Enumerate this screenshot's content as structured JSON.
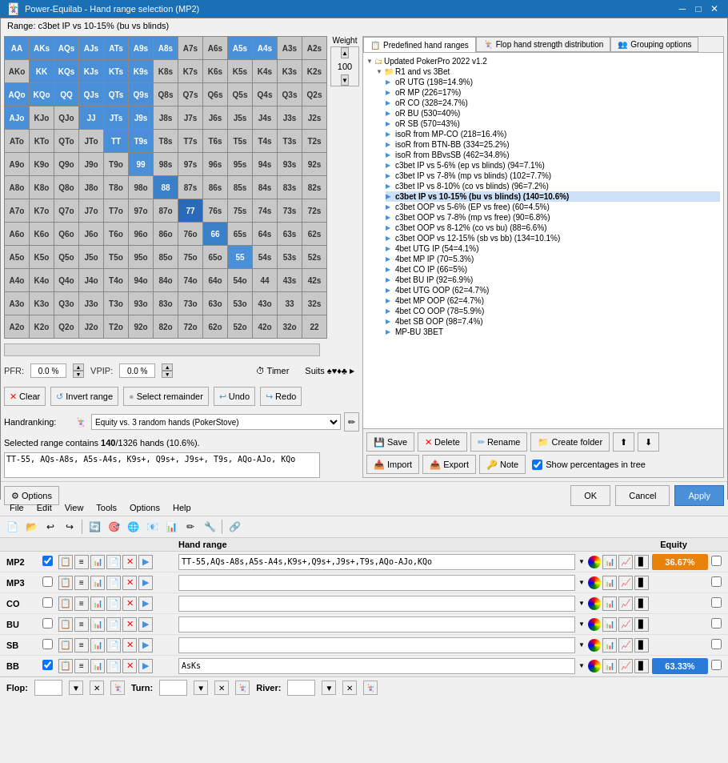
{
  "titleBar": {
    "title": "Power-Equilab - Hand range selection (MP2)",
    "minBtn": "─",
    "maxBtn": "□",
    "closeBtn": "✕"
  },
  "mainWindow": {
    "rangeLabel": "Range: c3bet IP vs 10-15% (bu vs blinds)",
    "weightLabel": "Weight",
    "weightValue": "100"
  },
  "handGrid": {
    "cells": [
      {
        "label": "AA",
        "style": "blue"
      },
      {
        "label": "AKs",
        "style": "blue"
      },
      {
        "label": "AQs",
        "style": "blue"
      },
      {
        "label": "AJs",
        "style": "blue"
      },
      {
        "label": "ATs",
        "style": "blue"
      },
      {
        "label": "A9s",
        "style": "blue"
      },
      {
        "label": "A8s",
        "style": "blue"
      },
      {
        "label": "A7s",
        "style": "gray"
      },
      {
        "label": "A6s",
        "style": "gray"
      },
      {
        "label": "A5s",
        "style": "blue"
      },
      {
        "label": "A4s",
        "style": "blue"
      },
      {
        "label": "A3s",
        "style": "gray"
      },
      {
        "label": "A2s",
        "style": "gray"
      },
      {
        "label": "AKo",
        "style": "gray"
      },
      {
        "label": "KK",
        "style": "blue"
      },
      {
        "label": "KQs",
        "style": "blue"
      },
      {
        "label": "KJs",
        "style": "blue"
      },
      {
        "label": "KTs",
        "style": "blue"
      },
      {
        "label": "K9s",
        "style": "blue"
      },
      {
        "label": "K8s",
        "style": "gray"
      },
      {
        "label": "K7s",
        "style": "gray"
      },
      {
        "label": "K6s",
        "style": "gray"
      },
      {
        "label": "K5s",
        "style": "gray"
      },
      {
        "label": "K4s",
        "style": "gray"
      },
      {
        "label": "K3s",
        "style": "gray"
      },
      {
        "label": "K2s",
        "style": "gray"
      },
      {
        "label": "AQo",
        "style": "blue"
      },
      {
        "label": "KQo",
        "style": "gray"
      },
      {
        "label": "QQ",
        "style": "blue"
      },
      {
        "label": "QJs",
        "style": "blue"
      },
      {
        "label": "QTs",
        "style": "blue"
      },
      {
        "label": "Q9s",
        "style": "blue"
      },
      {
        "label": "Q8s",
        "style": "gray"
      },
      {
        "label": "Q7s",
        "style": "gray"
      },
      {
        "label": "Q6s",
        "style": "gray"
      },
      {
        "label": "Q5s",
        "style": "gray"
      },
      {
        "label": "Q4s",
        "style": "gray"
      },
      {
        "label": "Q3s",
        "style": "gray"
      },
      {
        "label": "Q2s",
        "style": "gray"
      },
      {
        "label": "AJo",
        "style": "blue"
      },
      {
        "label": "KJo",
        "style": "gray"
      },
      {
        "label": "QJo",
        "style": "gray"
      },
      {
        "label": "JJ",
        "style": "blue"
      },
      {
        "label": "JTs",
        "style": "blue"
      },
      {
        "label": "J9s",
        "style": "blue"
      },
      {
        "label": "J8s",
        "style": "gray"
      },
      {
        "label": "J7s",
        "style": "gray"
      },
      {
        "label": "J6s",
        "style": "gray"
      },
      {
        "label": "J5s",
        "style": "gray"
      },
      {
        "label": "J4s",
        "style": "gray"
      },
      {
        "label": "J3s",
        "style": "gray"
      },
      {
        "label": "J2s",
        "style": "gray"
      },
      {
        "label": "ATo",
        "style": "gray"
      },
      {
        "label": "KTo",
        "style": "gray"
      },
      {
        "label": "QTo",
        "style": "gray"
      },
      {
        "label": "JTo",
        "style": "gray"
      },
      {
        "label": "TT",
        "style": "blue"
      },
      {
        "label": "T9s",
        "style": "blue"
      },
      {
        "label": "T8s",
        "style": "gray"
      },
      {
        "label": "T7s",
        "style": "gray"
      },
      {
        "label": "T6s",
        "style": "gray"
      },
      {
        "label": "T5s",
        "style": "gray"
      },
      {
        "label": "T4s",
        "style": "gray"
      },
      {
        "label": "T3s",
        "style": "gray"
      },
      {
        "label": "T2s",
        "style": "gray"
      },
      {
        "label": "A9o",
        "style": "gray"
      },
      {
        "label": "K9o",
        "style": "gray"
      },
      {
        "label": "Q9o",
        "style": "gray"
      },
      {
        "label": "J9o",
        "style": "gray"
      },
      {
        "label": "T9o",
        "style": "gray"
      },
      {
        "label": "99",
        "style": "blue"
      },
      {
        "label": "98s",
        "style": "gray"
      },
      {
        "label": "97s",
        "style": "gray"
      },
      {
        "label": "96s",
        "style": "gray"
      },
      {
        "label": "95s",
        "style": "gray"
      },
      {
        "label": "94s",
        "style": "gray"
      },
      {
        "label": "93s",
        "style": "gray"
      },
      {
        "label": "92s",
        "style": "gray"
      },
      {
        "label": "A8o",
        "style": "gray"
      },
      {
        "label": "K8o",
        "style": "gray"
      },
      {
        "label": "Q8o",
        "style": "gray"
      },
      {
        "label": "J8o",
        "style": "gray"
      },
      {
        "label": "T8o",
        "style": "gray"
      },
      {
        "label": "98o",
        "style": "gray"
      },
      {
        "label": "88",
        "style": "blue"
      },
      {
        "label": "87s",
        "style": "gray"
      },
      {
        "label": "86s",
        "style": "gray"
      },
      {
        "label": "85s",
        "style": "gray"
      },
      {
        "label": "84s",
        "style": "gray"
      },
      {
        "label": "83s",
        "style": "gray"
      },
      {
        "label": "82s",
        "style": "gray"
      },
      {
        "label": "A7o",
        "style": "gray"
      },
      {
        "label": "K7o",
        "style": "gray"
      },
      {
        "label": "Q7o",
        "style": "gray"
      },
      {
        "label": "J7o",
        "style": "gray"
      },
      {
        "label": "T7o",
        "style": "gray"
      },
      {
        "label": "97o",
        "style": "gray"
      },
      {
        "label": "87o",
        "style": "gray"
      },
      {
        "label": "77",
        "style": "blue"
      },
      {
        "label": "76s",
        "style": "gray"
      },
      {
        "label": "75s",
        "style": "gray"
      },
      {
        "label": "74s",
        "style": "gray"
      },
      {
        "label": "73s",
        "style": "gray"
      },
      {
        "label": "72s",
        "style": "gray"
      },
      {
        "label": "A6o",
        "style": "gray"
      },
      {
        "label": "K6o",
        "style": "gray"
      },
      {
        "label": "Q6o",
        "style": "gray"
      },
      {
        "label": "J6o",
        "style": "gray"
      },
      {
        "label": "T6o",
        "style": "gray"
      },
      {
        "label": "96o",
        "style": "gray"
      },
      {
        "label": "86o",
        "style": "gray"
      },
      {
        "label": "76o",
        "style": "gray"
      },
      {
        "label": "66",
        "style": "blue"
      },
      {
        "label": "65s",
        "style": "gray"
      },
      {
        "label": "64s",
        "style": "gray"
      },
      {
        "label": "63s",
        "style": "gray"
      },
      {
        "label": "62s",
        "style": "gray"
      },
      {
        "label": "A5o",
        "style": "gray"
      },
      {
        "label": "K5o",
        "style": "gray"
      },
      {
        "label": "Q5o",
        "style": "gray"
      },
      {
        "label": "J5o",
        "style": "gray"
      },
      {
        "label": "T5o",
        "style": "gray"
      },
      {
        "label": "95o",
        "style": "gray"
      },
      {
        "label": "85o",
        "style": "gray"
      },
      {
        "label": "75o",
        "style": "gray"
      },
      {
        "label": "65o",
        "style": "gray"
      },
      {
        "label": "55",
        "style": "blue"
      },
      {
        "label": "54s",
        "style": "gray"
      },
      {
        "label": "53s",
        "style": "gray"
      },
      {
        "label": "52s",
        "style": "gray"
      },
      {
        "label": "A4o",
        "style": "gray"
      },
      {
        "label": "K4o",
        "style": "gray"
      },
      {
        "label": "Q4o",
        "style": "gray"
      },
      {
        "label": "J4o",
        "style": "gray"
      },
      {
        "label": "T4o",
        "style": "gray"
      },
      {
        "label": "94o",
        "style": "gray"
      },
      {
        "label": "84o",
        "style": "gray"
      },
      {
        "label": "74o",
        "style": "gray"
      },
      {
        "label": "64o",
        "style": "gray"
      },
      {
        "label": "54o",
        "style": "gray"
      },
      {
        "label": "44",
        "style": "gray"
      },
      {
        "label": "43s",
        "style": "gray"
      },
      {
        "label": "42s",
        "style": "gray"
      },
      {
        "label": "A3o",
        "style": "gray"
      },
      {
        "label": "K3o",
        "style": "gray"
      },
      {
        "label": "Q3o",
        "style": "gray"
      },
      {
        "label": "J3o",
        "style": "gray"
      },
      {
        "label": "T3o",
        "style": "gray"
      },
      {
        "label": "93o",
        "style": "gray"
      },
      {
        "label": "83o",
        "style": "gray"
      },
      {
        "label": "73o",
        "style": "gray"
      },
      {
        "label": "63o",
        "style": "gray"
      },
      {
        "label": "53o",
        "style": "gray"
      },
      {
        "label": "43o",
        "style": "gray"
      },
      {
        "label": "33",
        "style": "gray"
      },
      {
        "label": "32s",
        "style": "gray"
      },
      {
        "label": "A2o",
        "style": "gray"
      },
      {
        "label": "K2o",
        "style": "gray"
      },
      {
        "label": "Q2o",
        "style": "gray"
      },
      {
        "label": "J2o",
        "style": "gray"
      },
      {
        "label": "T2o",
        "style": "gray"
      },
      {
        "label": "92o",
        "style": "gray"
      },
      {
        "label": "82o",
        "style": "gray"
      },
      {
        "label": "72o",
        "style": "gray"
      },
      {
        "label": "62o",
        "style": "gray"
      },
      {
        "label": "52o",
        "style": "gray"
      },
      {
        "label": "42o",
        "style": "gray"
      },
      {
        "label": "32o",
        "style": "gray"
      },
      {
        "label": "22",
        "style": "gray"
      }
    ]
  },
  "stats": {
    "pfrLabel": "PFR:",
    "pfrValue": "0.0 %",
    "vpipLabel": "VPIP:",
    "vpipValue": "0.0 %",
    "timerLabel": "Timer",
    "suitsLabel": "Suits"
  },
  "actions": {
    "clearLabel": "Clear",
    "invertLabel": "Invert range",
    "selectRemLabel": "Select remainder",
    "undoLabel": "Undo",
    "redoLabel": "Redo"
  },
  "handranking": {
    "label": "Handranking:",
    "value": "Equity vs. 3 random hands (PokerStove)"
  },
  "selectedInfo": {
    "text": "Selected range contains ",
    "bold": "140",
    "rest": "/1326 hands (10.6%)."
  },
  "rangeText": "TT-55, AQs-A8s, A5s-A4s, K9s+, Q9s+, J9s+, T9s, AQo-AJo, KQo",
  "tree": {
    "tab1": "Predefined hand ranges",
    "tab2": "Flop hand strength distribution",
    "tab3": "Grouping options",
    "root": "Updated PokerPro 2022 v1.2",
    "folder1": "R1 and vs 3Bet",
    "items": [
      "oR UTG (198=14.9%)",
      "oR MP (226=17%)",
      "oR CO (328=24.7%)",
      "oR BU (530=40%)",
      "oR SB (570=43%)",
      "isoR from MP-CO (218=16.4%)",
      "isoR from BTN-BB (334=25.2%)",
      "isoR from BBvsSB (462=34.8%)",
      "c3bet IP vs 5-6% (ep vs blinds) (94=7.1%)",
      "c3bet IP vs 7-8% (mp vs blinds) (102=7.7%)",
      "c3bet IP vs 8-10% (co vs blinds) (96=7.2%)",
      "c3bet IP vs 10-15% (bu vs blinds) (140=10.6%)",
      "c3bet OOP vs 5-6% (EP vs free) (60=4.5%)",
      "c3bet OOP vs 7-8% (mp vs free) (90=6.8%)",
      "c3bet OOP vs 8-12% (co vs bu) (88=6.6%)",
      "c3bet OOP vs 12-15% (sb vs bb) (134=10.1%)",
      "4bet UTG IP (54=4.1%)",
      "4bet MP IP (70=5.3%)",
      "4bet CO IP (66=5%)",
      "4bet BU IP (92=6.9%)",
      "4bet UTG OOP (62=4.7%)",
      "4bet MP OOP (62=4.7%)",
      "4bet CO OOP (78=5.9%)",
      "4bet SB OOP (98=7.4%)",
      "MP-BU 3BET"
    ]
  },
  "treeButtons": {
    "save": "Save",
    "delete": "Delete",
    "rename": "Rename",
    "createFolder": "Create folder",
    "importUp": "▲",
    "importDown": "▼",
    "import": "Import",
    "export": "Export",
    "note": "Note",
    "showPct": "Show percentages in tree"
  },
  "bottomSection": {
    "menuItems": [
      "File",
      "Edit",
      "View",
      "Tools",
      "Options",
      "Help"
    ],
    "tableHeader": {
      "handRange": "Hand range",
      "equity": "Equity"
    },
    "players": [
      {
        "name": "MP2",
        "checked": true,
        "range": "TT-55,AQs-A8s,A5s-A4s,K9s+,Q9s+,J9s+,T9s,AQo-AJo,KQo",
        "equity": "36.67%",
        "equityStyle": "orange"
      },
      {
        "name": "MP3",
        "checked": false,
        "range": "",
        "equity": "",
        "equityStyle": ""
      },
      {
        "name": "CO",
        "checked": false,
        "range": "",
        "equity": "",
        "equityStyle": ""
      },
      {
        "name": "BU",
        "checked": false,
        "range": "",
        "equity": "",
        "equityStyle": ""
      },
      {
        "name": "SB",
        "checked": false,
        "range": "",
        "equity": "",
        "equityStyle": ""
      },
      {
        "name": "BB",
        "checked": true,
        "range": "AsKs",
        "equity": "63.33%",
        "equityStyle": "blue"
      }
    ],
    "board": {
      "flopLabel": "Flop:",
      "turnLabel": "Turn:",
      "riverLabel": "River:"
    }
  },
  "optionsRow": {
    "optionsLabel": "Options",
    "cancelLabel": "Cancel",
    "applyLabel": "Apply",
    "okLabel": "OK"
  }
}
